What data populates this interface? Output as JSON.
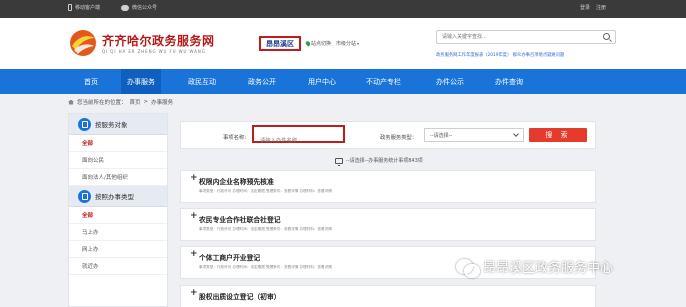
{
  "topbar": {
    "mobile_label": "移动客户端",
    "wechat_label": "微信公众号",
    "login_label": "登录",
    "register_label": "注册"
  },
  "header": {
    "site_title": "齐齐哈尔政务服务网",
    "site_subtitle": "QI QI HA ER ZHENG WU FU WU WANG",
    "region": "昂昂溪区",
    "switch_label": "站点切换",
    "city_label": "市级分站",
    "search_placeholder": "请输入关键字查找...",
    "notice_text": "政务服务网工作年度报表（2019年度） 群众办事百项堵点疑难问题"
  },
  "nav": {
    "items": [
      "首页",
      "办事服务",
      "政民互动",
      "政务公开",
      "用户中心",
      "不动产专栏",
      "办件公示",
      "办件查询"
    ],
    "active": "办事服务"
  },
  "breadcrumb": {
    "prefix": "您当前所在的位置：",
    "home": "首页",
    "sep": ">",
    "current": "办事服务"
  },
  "sidebar": {
    "section1_title": "按服务对象",
    "section1_items": [
      "全部",
      "面向公民",
      "面向法人/其他组织"
    ],
    "section2_title": "按照办事类型",
    "section2_items": [
      "全部",
      "马上办",
      "网上办",
      "就近办"
    ]
  },
  "filter": {
    "item_name_label": "事项名称：",
    "item_name_placeholder": "请输入办件名称",
    "service_type_label": "政务服务类型：",
    "service_type_value": "--请选择--",
    "search_button": "搜 索"
  },
  "summary": {
    "text": "--请选择--办事服务统计事项843项"
  },
  "services": [
    {
      "title": "权限内企业名称预先核准",
      "meta": "事项类型：行政许可 办理时间：法定期限 受理条件：查看详情 办理材料：查看详情"
    },
    {
      "title": "农民专业合作社联合社登记",
      "meta": "事项类型：行政许可 办理时间：法定期限 受理条件：查看详情 办理材料：查看详情"
    },
    {
      "title": "个体工商户开业登记",
      "meta": "事项类型：行政许可 办理时间：法定期限 受理条件：查看详情 办理材料：查看详情"
    },
    {
      "title": "股权出质设立登记（初审）",
      "meta": ""
    }
  ],
  "watermark": {
    "text": "昂昂溪区政务服务中心"
  },
  "colors": {
    "nav_blue": "#1a73d9",
    "brand_red": "#b41a1a",
    "highlight_red": "#c31a1a",
    "button_red": "#e53b2c"
  }
}
